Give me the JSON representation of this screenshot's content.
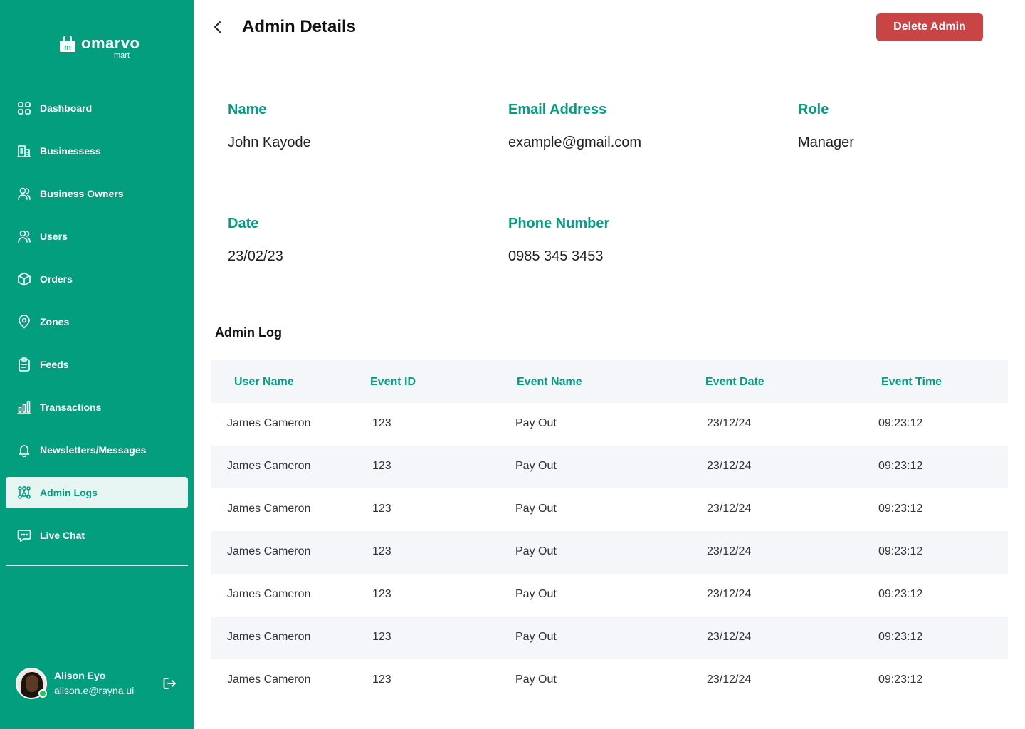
{
  "brand": {
    "name": "omarvo",
    "sub": "mart",
    "bag_letter": "m"
  },
  "colors": {
    "primary": "#029E7E",
    "danger": "#C94444",
    "row_alt": "#F4F6F9"
  },
  "sidebar": {
    "items": [
      {
        "label": "Dashboard",
        "icon": "grid-icon"
      },
      {
        "label": "Businessess",
        "icon": "building-icon"
      },
      {
        "label": "Business Owners",
        "icon": "users-icon"
      },
      {
        "label": "Users",
        "icon": "users-icon"
      },
      {
        "label": "Orders",
        "icon": "box-icon"
      },
      {
        "label": "Zones",
        "icon": "location-pin-icon"
      },
      {
        "label": "Feeds",
        "icon": "clipboard-icon"
      },
      {
        "label": "Transactions",
        "icon": "bar-chart-icon"
      },
      {
        "label": "Newsletters/Messages",
        "icon": "bell-icon"
      },
      {
        "label": "Admin Logs",
        "icon": "network-icon",
        "active": true
      },
      {
        "label": "Live Chat",
        "icon": "chat-icon"
      }
    ],
    "profile": {
      "name": "Alison Eyo",
      "email": "alison.e@rayna.ui"
    }
  },
  "header": {
    "title": "Admin Details",
    "delete_label": "Delete Admin"
  },
  "details": {
    "name": {
      "label": "Name",
      "value": "John Kayode"
    },
    "email": {
      "label": "Email Address",
      "value": "example@gmail.com"
    },
    "role": {
      "label": "Role",
      "value": "Manager"
    },
    "date": {
      "label": "Date",
      "value": "23/02/23"
    },
    "phone": {
      "label": "Phone Number",
      "value": "0985 345 3453"
    }
  },
  "log": {
    "title": "Admin Log",
    "columns": [
      "User Name",
      "Event ID",
      "Event Name",
      "Event Date",
      "Event Time"
    ],
    "rows": [
      [
        "James Cameron",
        "123",
        "Pay Out",
        "23/12/24",
        "09:23:12"
      ],
      [
        "James Cameron",
        "123",
        "Pay Out",
        "23/12/24",
        "09:23:12"
      ],
      [
        "James Cameron",
        "123",
        "Pay Out",
        "23/12/24",
        "09:23:12"
      ],
      [
        "James Cameron",
        "123",
        "Pay Out",
        "23/12/24",
        "09:23:12"
      ],
      [
        "James Cameron",
        "123",
        "Pay Out",
        "23/12/24",
        "09:23:12"
      ],
      [
        "James Cameron",
        "123",
        "Pay Out",
        "23/12/24",
        "09:23:12"
      ],
      [
        "James Cameron",
        "123",
        "Pay Out",
        "23/12/24",
        "09:23:12"
      ]
    ]
  }
}
